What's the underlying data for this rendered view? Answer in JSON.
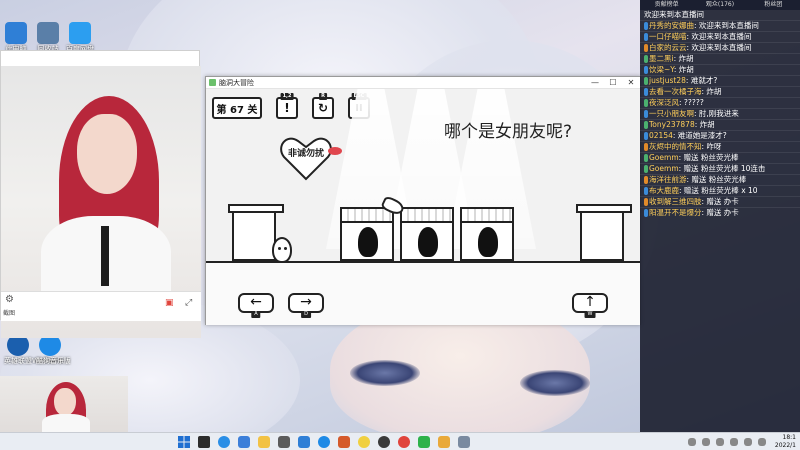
{
  "desktop": {
    "icons_top": [
      {
        "label": "此电脑",
        "color": "#2f7fd6"
      },
      {
        "label": "回收站",
        "color": "#5a7fa8"
      },
      {
        "label": "百度网盘",
        "color": "#2c9ef0"
      }
    ],
    "icons_mid": [
      {
        "label": "英雄联盟WeGame版",
        "color": "#1b5fae"
      },
      {
        "label": "酷狗音乐",
        "color": "#1e8ae6"
      }
    ]
  },
  "webcam": {
    "bottom_label": "截图"
  },
  "game": {
    "window_title": "脑洞大冒险",
    "controls": {
      "minimize": "—",
      "maximize": "☐",
      "close": "✕"
    },
    "level_label": "第 67 关",
    "hud": [
      {
        "name": "hint",
        "symbol": "!",
        "key": "1,2"
      },
      {
        "name": "restart",
        "symbol": "↻",
        "key": "R"
      },
      {
        "name": "pause",
        "symbol": "II",
        "key": "ESC"
      }
    ],
    "question": "哪个是女朋友呢?",
    "sign_text": "非诚勿扰",
    "arrows": [
      {
        "symbol": "←",
        "key": "A"
      },
      {
        "symbol": "→",
        "key": "D"
      },
      {
        "symbol": "↑",
        "key": "W"
      }
    ]
  },
  "chat": {
    "tabs": [
      "贡献榜单",
      "观众(176)",
      "粉丝团"
    ],
    "messages": [
      {
        "badges": [],
        "nick": "",
        "text": "欢迎来到本直播间"
      },
      {
        "badges": [
          {
            "t": "",
            "c": "b"
          }
        ],
        "nick": "丹秀的安娜曲",
        "text": "欢迎来到本直播间"
      },
      {
        "badges": [
          {
            "t": "",
            "c": "b"
          }
        ],
        "nick": "一口仔喵喵",
        "text": "欢迎来到本直播间"
      },
      {
        "badges": [
          {
            "t": "",
            "c": "o"
          }
        ],
        "nick": "白家的云云",
        "text": "欢迎来到本直播间"
      },
      {
        "badges": [
          {
            "t": "",
            "c": "g"
          }
        ],
        "nick": "墨二黑i",
        "text": "炸胡"
      },
      {
        "badges": [
          {
            "t": "",
            "c": "b"
          }
        ],
        "nick": "饮梁~Y",
        "text": "炸胡"
      },
      {
        "badges": [
          {
            "t": "",
            "c": "g"
          }
        ],
        "nick": "justjust28",
        "text": "难就才?"
      },
      {
        "badges": [
          {
            "t": "",
            "c": "b"
          }
        ],
        "nick": "去看一次橘子海",
        "text": "炸胡"
      },
      {
        "badges": [
          {
            "t": "",
            "c": "g"
          }
        ],
        "nick": "夜深泛风",
        "text": "?????"
      },
      {
        "badges": [
          {
            "t": "",
            "c": "b"
          }
        ],
        "nick": "一只小朋友啊",
        "text": "肘,刚我进来"
      },
      {
        "badges": [
          {
            "t": "",
            "c": "g"
          }
        ],
        "nick": "Tony237878",
        "text": "炸胡"
      },
      {
        "badges": [
          {
            "t": "",
            "c": "b"
          }
        ],
        "nick": "02154",
        "text": "难道她是漆才?"
      },
      {
        "badges": [
          {
            "t": "",
            "c": "o"
          }
        ],
        "nick": "灰烬中的情不知",
        "text": "咋呀"
      },
      {
        "badges": [
          {
            "t": "",
            "c": "g"
          }
        ],
        "nick": "Goemm",
        "text": "赠送 粉丝荧光棒"
      },
      {
        "badges": [
          {
            "t": "",
            "c": "g"
          }
        ],
        "nick": "Goemm",
        "text": "赠送 粉丝荧光棒 10连击"
      },
      {
        "badges": [
          {
            "t": "",
            "c": "o"
          }
        ],
        "nick": "海洋往前游",
        "text": "赠送 粉丝荧光棒"
      },
      {
        "badges": [
          {
            "t": "",
            "c": "b"
          }
        ],
        "nick": "布大鹿鹿",
        "text": "赠送 粉丝荧光棒 x 10"
      },
      {
        "badges": [
          {
            "t": "",
            "c": "o"
          }
        ],
        "nick": "收到解三维四肢",
        "text": "赠送 办卡"
      },
      {
        "badges": [
          {
            "t": "",
            "c": "b"
          }
        ],
        "nick": "阳温开不是爆分",
        "text": "赠送 办卡"
      }
    ]
  },
  "taskbar": {
    "time": "18:1",
    "date": "2022/1"
  }
}
